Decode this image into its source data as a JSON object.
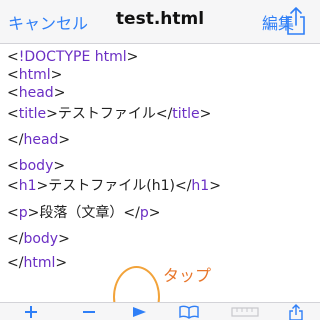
{
  "nav": {
    "cancel_label": "キャンセル",
    "title": "test.html",
    "edit_label": "編集",
    "share_icon": "share-icon"
  },
  "code": {
    "lines": [
      {
        "b1": "<",
        "t1": "!DOCTYPE html",
        "b2": ">"
      },
      {
        "b1": "<",
        "t1": "html",
        "b2": ">"
      },
      {
        "b1": "<",
        "t1": "head",
        "b2": ">"
      },
      {
        "b1": "<",
        "t1": "title",
        "b2": ">",
        "text": "テストファイル",
        "b3": "</",
        "t2": "title",
        "b4": ">"
      },
      {
        "b1": "</",
        "t1": "head",
        "b2": ">"
      },
      {
        "b1": "<",
        "t1": "body",
        "b2": ">"
      },
      {
        "b1": "<",
        "t1": "h1",
        "b2": ">",
        "text": "テストファイル(h1)",
        "b3": "</",
        "t2": "h1",
        "b4": ">"
      },
      {
        "b1": "<",
        "t1": "p",
        "b2": ">",
        "text": "段落（文章）",
        "b3": "</",
        "t2": "p",
        "b4": ">"
      },
      {
        "b1": "</",
        "t1": "body",
        "b2": ">"
      },
      {
        "b1": "</",
        "t1": "html",
        "b2": ">"
      }
    ]
  },
  "annotation": {
    "label": "タップ",
    "color": "#e8762b"
  },
  "toolbar": {
    "items": [
      "add-icon",
      "minus-icon",
      "play-icon",
      "book-icon",
      "ruler-icon",
      "share-icon"
    ]
  },
  "colors": {
    "accent": "#2f7ff7",
    "tag": "#6b2fc4",
    "highlight": "#f2a33a"
  }
}
